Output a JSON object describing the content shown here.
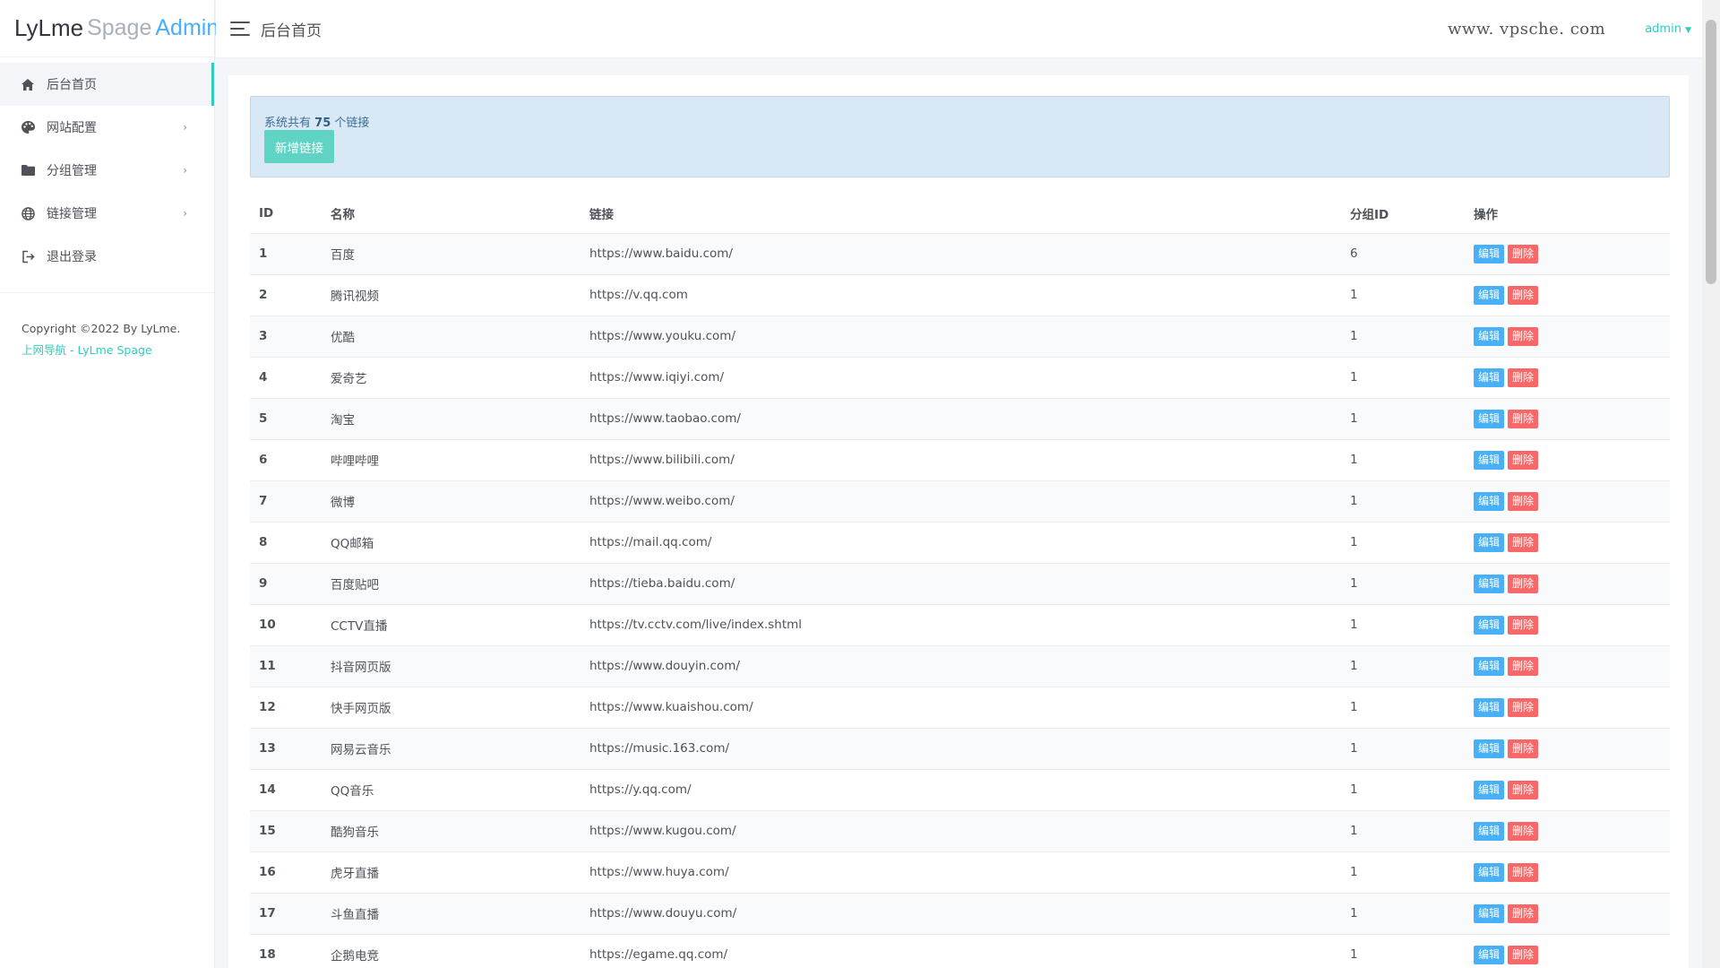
{
  "logo": {
    "part1": "LyLme",
    "part2": "Spage",
    "part3": "Admin"
  },
  "header": {
    "title": "后台首页",
    "watermark": "www. vpsche. com",
    "user": "admin"
  },
  "sidebar": {
    "items": [
      {
        "label": "后台首页",
        "icon": "home-icon",
        "active": true,
        "has_arrow": false
      },
      {
        "label": "网站配置",
        "icon": "palette-icon",
        "active": false,
        "has_arrow": true
      },
      {
        "label": "分组管理",
        "icon": "folder-icon",
        "active": false,
        "has_arrow": true
      },
      {
        "label": "链接管理",
        "icon": "globe-icon",
        "active": false,
        "has_arrow": true
      },
      {
        "label": "退出登录",
        "icon": "logout-icon",
        "active": false,
        "has_arrow": false
      }
    ],
    "arrow": "›",
    "copyright": "Copyright ©2022 By LyLme.",
    "copyright_link": "上网导航 - LyLme Spage"
  },
  "alert": {
    "prefix": "系统共有",
    "count": "75",
    "suffix": "个链接",
    "add_button": "新增链接"
  },
  "table": {
    "columns": [
      "ID",
      "名称",
      "链接",
      "分组ID",
      "操作"
    ],
    "edit_label": "编辑",
    "delete_label": "删除",
    "rows": [
      {
        "id": "1",
        "name": "百度",
        "url": "https://www.baidu.com/",
        "group": "6"
      },
      {
        "id": "2",
        "name": "腾讯视频",
        "url": "https://v.qq.com",
        "group": "1"
      },
      {
        "id": "3",
        "name": "优酷",
        "url": "https://www.youku.com/",
        "group": "1"
      },
      {
        "id": "4",
        "name": "爱奇艺",
        "url": "https://www.iqiyi.com/",
        "group": "1"
      },
      {
        "id": "5",
        "name": "淘宝",
        "url": "https://www.taobao.com/",
        "group": "1"
      },
      {
        "id": "6",
        "name": "哔哩哔哩",
        "url": "https://www.bilibili.com/",
        "group": "1"
      },
      {
        "id": "7",
        "name": "微博",
        "url": "https://www.weibo.com/",
        "group": "1"
      },
      {
        "id": "8",
        "name": "QQ邮箱",
        "url": "https://mail.qq.com/",
        "group": "1"
      },
      {
        "id": "9",
        "name": "百度贴吧",
        "url": "https://tieba.baidu.com/",
        "group": "1"
      },
      {
        "id": "10",
        "name": "CCTV直播",
        "url": "https://tv.cctv.com/live/index.shtml",
        "group": "1"
      },
      {
        "id": "11",
        "name": "抖音网页版",
        "url": "https://www.douyin.com/",
        "group": "1"
      },
      {
        "id": "12",
        "name": "快手网页版",
        "url": "https://www.kuaishou.com/",
        "group": "1"
      },
      {
        "id": "13",
        "name": "网易云音乐",
        "url": "https://music.163.com/",
        "group": "1"
      },
      {
        "id": "14",
        "name": "QQ音乐",
        "url": "https://y.qq.com/",
        "group": "1"
      },
      {
        "id": "15",
        "name": "酷狗音乐",
        "url": "https://www.kugou.com/",
        "group": "1"
      },
      {
        "id": "16",
        "name": "虎牙直播",
        "url": "https://www.huya.com/",
        "group": "1"
      },
      {
        "id": "17",
        "name": "斗鱼直播",
        "url": "https://www.douyu.com/",
        "group": "1"
      },
      {
        "id": "18",
        "name": "企鹅电竞",
        "url": "https://egame.qq.com/",
        "group": "1"
      }
    ]
  },
  "colors": {
    "accent": "#33cabb",
    "edit": "#48b0f7",
    "delete": "#f96868",
    "alert_bg": "#d8e8f5"
  }
}
